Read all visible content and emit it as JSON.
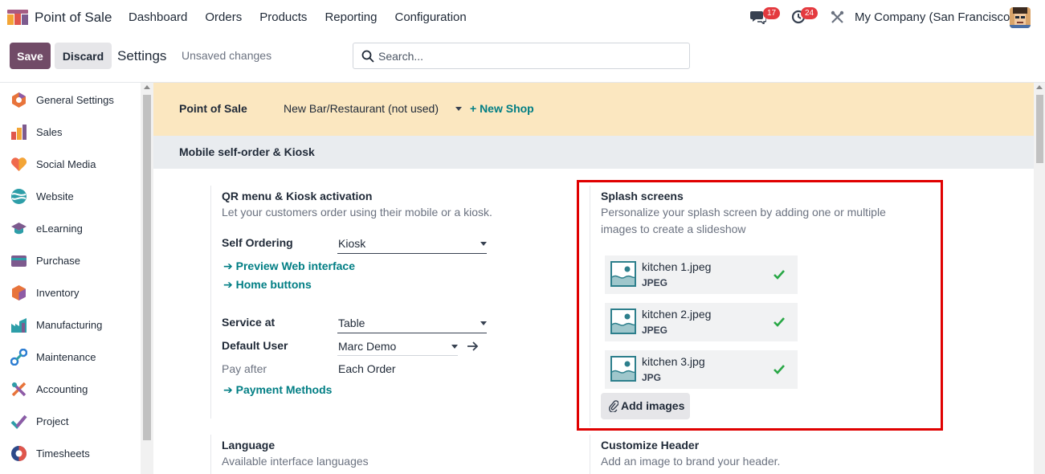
{
  "navbar": {
    "app_name": "Point of Sale",
    "menu": [
      "Dashboard",
      "Orders",
      "Products",
      "Reporting",
      "Configuration"
    ],
    "chat_badge": "17",
    "activity_badge": "24",
    "company": "My Company (San Francisco)"
  },
  "control_panel": {
    "save_label": "Save",
    "discard_label": "Discard",
    "title": "Settings",
    "status": "Unsaved changes",
    "search_placeholder": "Search..."
  },
  "sidebar": {
    "items": [
      {
        "label": "General Settings",
        "icon": "general-settings-icon"
      },
      {
        "label": "Sales",
        "icon": "sales-icon"
      },
      {
        "label": "Social Media",
        "icon": "social-media-icon"
      },
      {
        "label": "Website",
        "icon": "website-icon"
      },
      {
        "label": "eLearning",
        "icon": "elearning-icon"
      },
      {
        "label": "Purchase",
        "icon": "purchase-icon"
      },
      {
        "label": "Inventory",
        "icon": "inventory-icon"
      },
      {
        "label": "Manufacturing",
        "icon": "manufacturing-icon"
      },
      {
        "label": "Maintenance",
        "icon": "maintenance-icon"
      },
      {
        "label": "Accounting",
        "icon": "accounting-icon"
      },
      {
        "label": "Project",
        "icon": "project-icon"
      },
      {
        "label": "Timesheets",
        "icon": "timesheets-icon"
      }
    ]
  },
  "shop_bar": {
    "label": "Point of Sale",
    "selected_shop": "New Bar/Restaurant (not used)",
    "new_shop_label": "+ New Shop"
  },
  "section": {
    "title": "Mobile self-order & Kiosk"
  },
  "qr_menu": {
    "title": "QR menu & Kiosk activation",
    "description": "Let your customers order using their mobile or a kiosk.",
    "self_ordering_label": "Self Ordering",
    "self_ordering_value": "Kiosk",
    "preview_link": "Preview Web interface",
    "home_buttons_link": "Home buttons",
    "service_at_label": "Service at",
    "service_at_value": "Table",
    "default_user_label": "Default User",
    "default_user_value": "Marc Demo",
    "pay_after_label": "Pay after",
    "pay_after_value": "Each Order",
    "payment_methods_link": "Payment Methods"
  },
  "splash": {
    "title": "Splash screens",
    "description_line1": "Personalize your splash screen by adding one or multiple",
    "description_line2": "images to create a slideshow",
    "files": [
      {
        "name": "kitchen 1.jpeg",
        "type": "JPEG"
      },
      {
        "name": "kitchen 2.jpeg",
        "type": "JPEG"
      },
      {
        "name": "kitchen 3.jpg",
        "type": "JPG"
      }
    ],
    "add_images_label": "Add images"
  },
  "language": {
    "title": "Language",
    "description": "Available interface languages"
  },
  "header_setting": {
    "title": "Customize Header",
    "description": "Add an image to brand your header."
  },
  "colors": {
    "brand": "#714b67",
    "link": "#017e84",
    "highlight": "#e00000",
    "shop_bar": "#fbe7c0",
    "badge": "#e43a3f"
  }
}
